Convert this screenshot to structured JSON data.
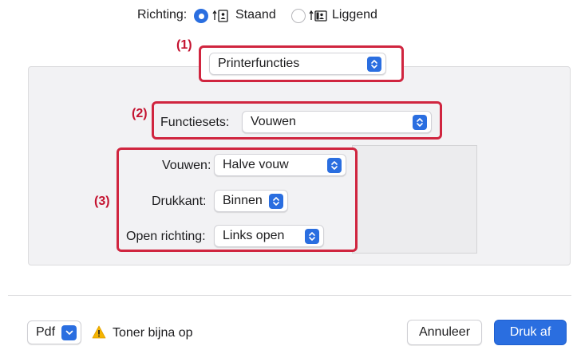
{
  "orientation": {
    "label": "Richting:",
    "options": [
      {
        "label": "Staand",
        "selected": true,
        "icon": "portrait-orientation-icon"
      },
      {
        "label": "Liggend",
        "selected": false,
        "icon": "landscape-orientation-icon"
      }
    ]
  },
  "callouts": {
    "one": "(1)",
    "two": "(2)",
    "three": "(3)"
  },
  "section_popup": {
    "value": "Printerfuncties"
  },
  "feature_sets": {
    "label": "Functiesets:",
    "value": "Vouwen"
  },
  "settings": [
    {
      "label": "Vouwen:",
      "value": "Halve vouw"
    },
    {
      "label": "Drukkant:",
      "value": "Binnen"
    },
    {
      "label": "Open richting:",
      "value": "Links open"
    }
  ],
  "footer": {
    "pdf_label": "Pdf",
    "warning_text": "Toner bijna op",
    "cancel_label": "Annuleer",
    "print_label": "Druk af"
  },
  "colors": {
    "accent": "#2a6ee0",
    "callout_red": "#d0253f",
    "warning": "#f5b400"
  }
}
